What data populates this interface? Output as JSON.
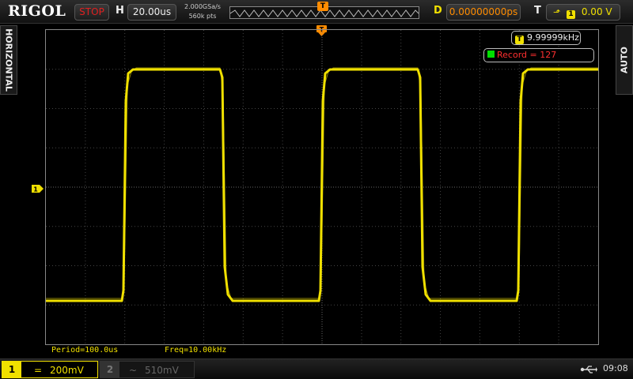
{
  "brand": "RIGOL",
  "status": "STOP",
  "horizontal": {
    "label": "H",
    "timebase": "20.00us",
    "sample_rate": "2.000GSa/s",
    "memory_depth": "560k pts"
  },
  "trigger_marker": "T",
  "delay": {
    "label": "D",
    "value": "0.00000000ps"
  },
  "trigger": {
    "label": "T",
    "source": "1",
    "level": "0.00 V"
  },
  "side_tabs": {
    "left": "HORIZONTAL",
    "right": "AUTO"
  },
  "freq_counter": {
    "badge": "T",
    "value": "9.99999kHz"
  },
  "record": {
    "text": "Record = 127"
  },
  "channel_marker": "1",
  "measurements": {
    "period": "Period=100.0us",
    "freq": "Freq=10.00kHz"
  },
  "channels": [
    {
      "num": "1",
      "coupling": "=",
      "scale": "200mV",
      "active": true
    },
    {
      "num": "2",
      "coupling": "~",
      "scale": "510mV",
      "active": false
    }
  ],
  "clock": "09:08",
  "colors": {
    "ch1": "#f0e000",
    "stop": "#e02020",
    "record": "#ff3030",
    "accent_orange": "#ff8c00"
  }
}
